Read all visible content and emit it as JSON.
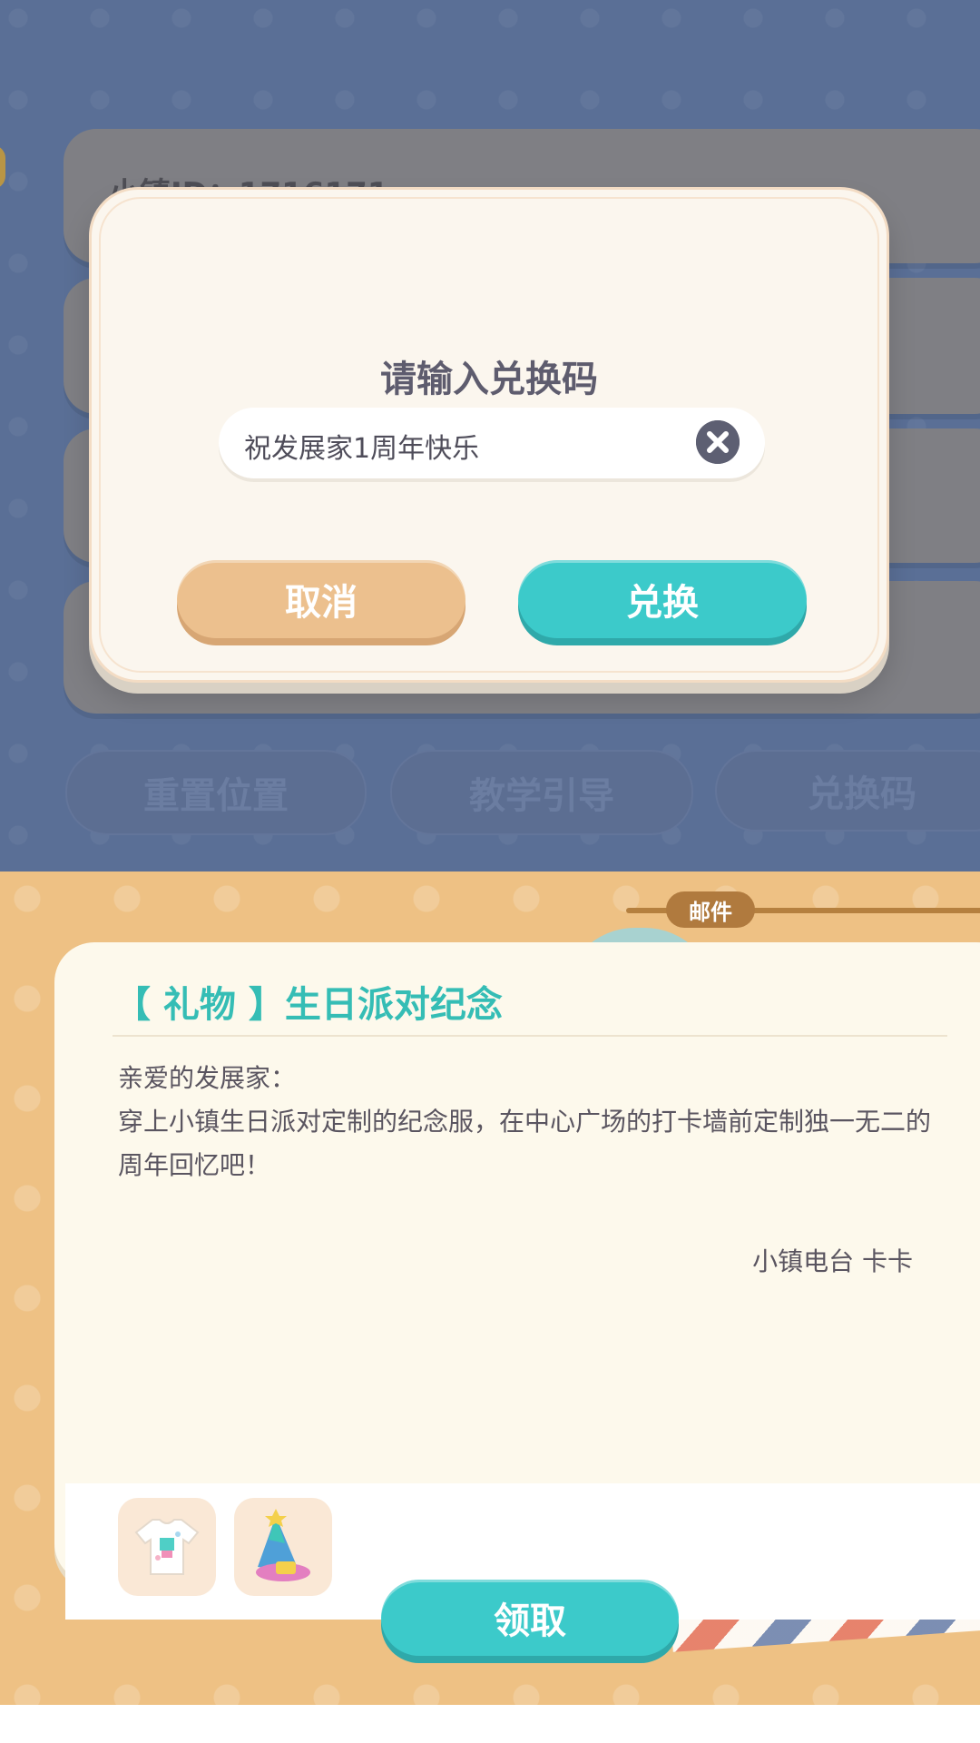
{
  "settings": {
    "row1_label": "小镇ID：1716171",
    "bottom_buttons": [
      "重置位置",
      "教学引导",
      "兑换码"
    ]
  },
  "dialog": {
    "title": "请输入兑换码",
    "input_value": "祝发展家1周年快乐",
    "cancel_label": "取消",
    "redeem_label": "兑换",
    "clear_icon": "close-circle-icon"
  },
  "mail": {
    "tag": "邮件",
    "title": "【 礼物 】生日派对纪念",
    "greeting": "亲爱的发展家：",
    "body": "穿上小镇生日派对定制的纪念服，在中心广场的打卡墙前定制独一无二的周年回忆吧！",
    "signature": "小镇电台 卡卡",
    "attachments": [
      "tshirt-icon",
      "party-hat-icon"
    ],
    "claim_label": "领取"
  },
  "colors": {
    "accent_teal": "#3ccaca",
    "cancel_orange": "#ecc08e",
    "title_teal": "#35bdb5"
  }
}
